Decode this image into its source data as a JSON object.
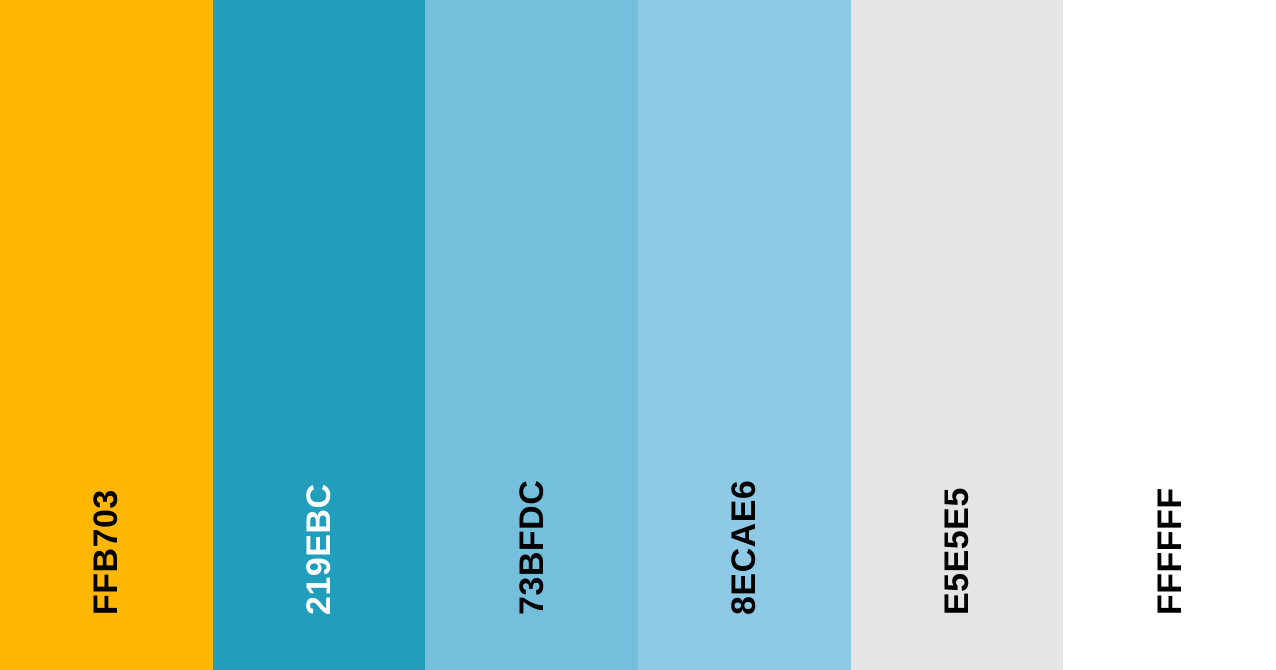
{
  "palette": {
    "swatches": [
      {
        "code": "FFB703",
        "color": "#FFB703",
        "text_color": "#000000"
      },
      {
        "code": "219EBC",
        "color": "#219EBC",
        "text_color": "#FFFFFF"
      },
      {
        "code": "73BFDC",
        "color": "#73BFDC",
        "text_color": "#000000"
      },
      {
        "code": "8ECAE6",
        "color": "#8ECAE6",
        "text_color": "#000000"
      },
      {
        "code": "E5E5E5",
        "color": "#E5E5E5",
        "text_color": "#000000"
      },
      {
        "code": "FFFFFF",
        "color": "#FFFFFF",
        "text_color": "#000000"
      }
    ]
  }
}
